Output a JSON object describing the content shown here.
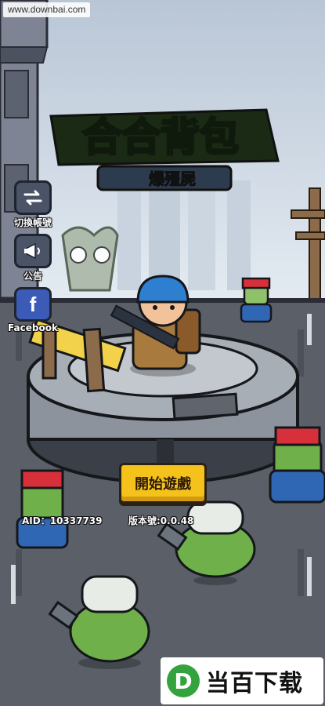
{
  "watermark": {
    "site": "www.downbai.com"
  },
  "logo": {
    "title": "合合背包",
    "subtitle": "爆殭屍"
  },
  "side_menu": [
    {
      "label": "切換帳號",
      "icon": "switch-account-icon"
    },
    {
      "label": "公告",
      "icon": "megaphone-icon"
    },
    {
      "label": "Facebook",
      "icon": "facebook-icon"
    }
  ],
  "start_button": {
    "label": "開始遊戲"
  },
  "account": {
    "aid": "AID：10337739"
  },
  "version": {
    "text": "版本號:0.0.48"
  },
  "brand": {
    "letter": "D",
    "name": "当百下载"
  },
  "colors": {
    "start_button": "#f5c21b",
    "logo_green": "#3fae3a",
    "player_helmet": "#2f7fd0",
    "zombie_green": "#6fb04a",
    "zombie_cap": "#d8303a"
  }
}
